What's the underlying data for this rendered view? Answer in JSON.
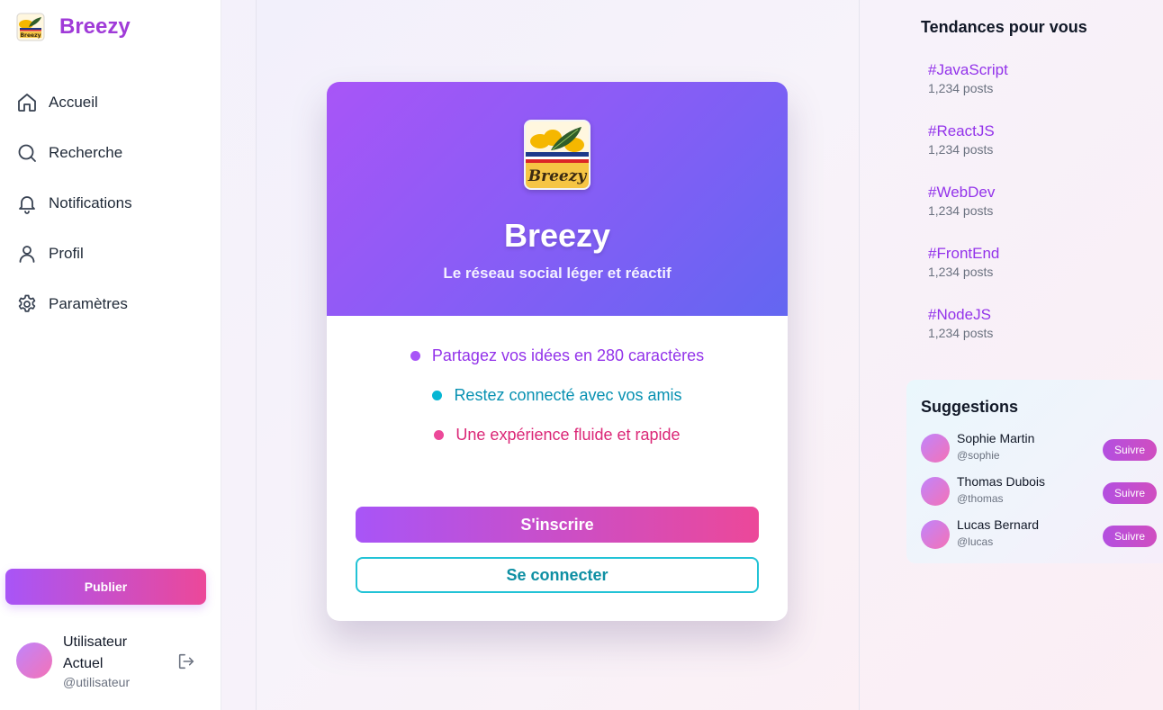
{
  "brand": {
    "name": "Breezy",
    "logo_icon": "breezy-logo-icon"
  },
  "sidebar": {
    "items": [
      {
        "label": "Accueil",
        "icon": "home-icon"
      },
      {
        "label": "Recherche",
        "icon": "search-icon"
      },
      {
        "label": "Notifications",
        "icon": "bell-icon"
      },
      {
        "label": "Profil",
        "icon": "user-icon"
      },
      {
        "label": "Paramètres",
        "icon": "gear-icon"
      }
    ],
    "publish_label": "Publier",
    "user": {
      "name": "Utilisateur Actuel",
      "handle": "@utilisateur",
      "logout_icon": "logout-icon"
    }
  },
  "welcome_card": {
    "title": "Breezy",
    "subtitle": "Le réseau social léger et réactif",
    "logo_text": "Breezy",
    "features": [
      {
        "text": "Partagez vos idées en 280 caractères",
        "color": "#9333ea"
      },
      {
        "text": "Restez connecté avec vos amis",
        "color": "#0891b2"
      },
      {
        "text": "Une expérience fluide et rapide",
        "color": "#db2777"
      }
    ],
    "signup_label": "S'inscrire",
    "login_label": "Se connecter"
  },
  "trends": {
    "title": "Tendances pour vous",
    "items": [
      {
        "tag": "#JavaScript",
        "count": "1,234 posts"
      },
      {
        "tag": "#ReactJS",
        "count": "1,234 posts"
      },
      {
        "tag": "#WebDev",
        "count": "1,234 posts"
      },
      {
        "tag": "#FrontEnd",
        "count": "1,234 posts"
      },
      {
        "tag": "#NodeJS",
        "count": "1,234 posts"
      }
    ]
  },
  "suggestions": {
    "title": "Suggestions",
    "follow_label": "Suivre",
    "users": [
      {
        "name": "Sophie Martin",
        "handle": "@sophie"
      },
      {
        "name": "Thomas Dubois",
        "handle": "@thomas"
      },
      {
        "name": "Lucas Bernard",
        "handle": "@lucas"
      }
    ]
  },
  "colors": {
    "brand": "#a03bd8",
    "accent_gradient_start": "#a855f7",
    "accent_gradient_end": "#ec4899",
    "hero_gradient_end": "#6366f1",
    "secondary": "#06b6d4"
  }
}
